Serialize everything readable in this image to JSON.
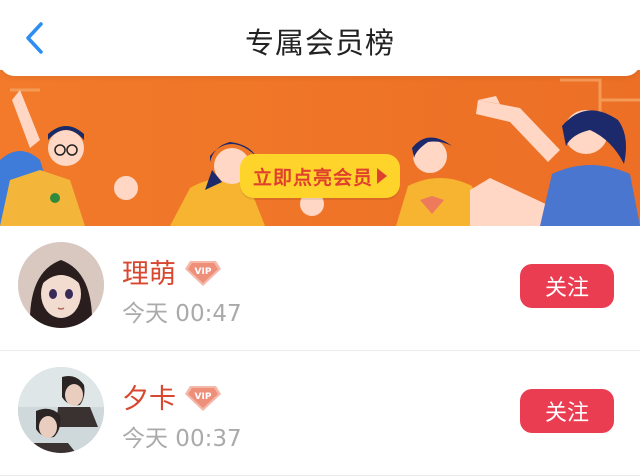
{
  "header": {
    "title": "专属会员榜",
    "back_icon": "chevron-left-icon"
  },
  "banner": {
    "cta_label": "立即点亮会员",
    "cta_icon": "play-arrow-icon",
    "bg_color": "#f07a2c"
  },
  "members": [
    {
      "name": "理萌",
      "badge": "VIP",
      "time": "今天 00:47",
      "follow_label": "关注"
    },
    {
      "name": "夕卡",
      "badge": "VIP",
      "time": "今天 00:37",
      "follow_label": "关注"
    }
  ],
  "colors": {
    "accent": "#ea3d52",
    "name": "#d8472f",
    "muted": "#aaaaaa"
  }
}
